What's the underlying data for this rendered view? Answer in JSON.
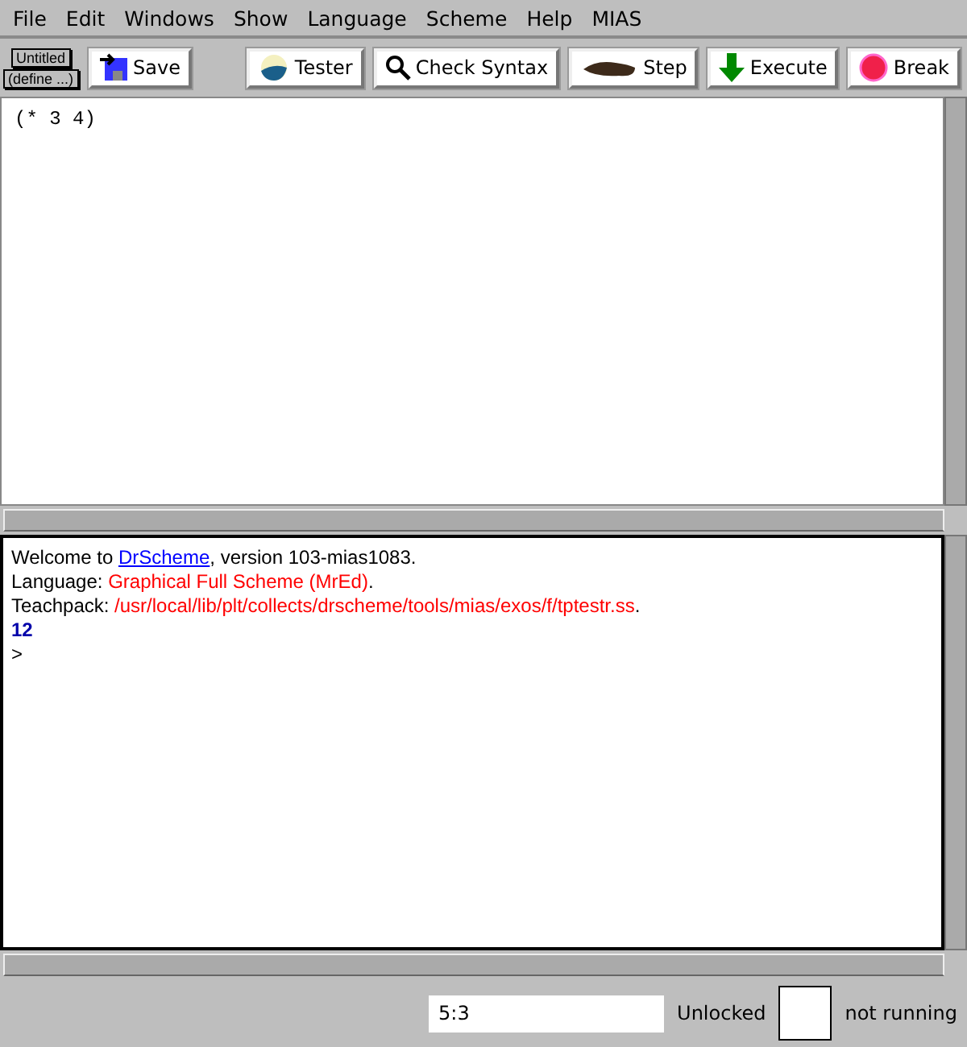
{
  "menu": [
    "File",
    "Edit",
    "Windows",
    "Show",
    "Language",
    "Scheme",
    "Help",
    "MIAS"
  ],
  "file_label": "Untitled",
  "define_menu": "(define ...)",
  "toolbar": [
    {
      "label": "Save",
      "kind": "save"
    },
    {
      "label": "Tester",
      "kind": "tester"
    },
    {
      "label": "Check Syntax",
      "kind": "check"
    },
    {
      "label": "Step",
      "kind": "step"
    },
    {
      "label": "Execute",
      "kind": "execute"
    },
    {
      "label": "Break",
      "kind": "break"
    }
  ],
  "editor": {
    "text": "(* 3 4)"
  },
  "interactions": [
    [
      {
        "text": "Welcome to ",
        "kind": "plain"
      },
      {
        "text": "DrScheme",
        "kind": "link"
      },
      {
        "text": ", version 103-mias1083.",
        "kind": "plain"
      }
    ],
    [
      {
        "text": "Language: ",
        "kind": "plain"
      },
      {
        "text": "Graphical Full Scheme (MrEd)",
        "kind": "red"
      },
      {
        "text": ".",
        "kind": "plain"
      }
    ],
    [
      {
        "text": "Teachpack: ",
        "kind": "plain"
      },
      {
        "text": "/usr/local/lib/plt/collects/drscheme/tools/mias/exos/f/tptestr.ss",
        "kind": "red"
      },
      {
        "text": ".",
        "kind": "plain"
      }
    ],
    [
      {
        "text": "12",
        "kind": "result"
      }
    ],
    [
      {
        "text": ">",
        "kind": "plain"
      }
    ]
  ],
  "status": {
    "position": "5:3",
    "lock": "Unlocked",
    "running": "not running"
  }
}
